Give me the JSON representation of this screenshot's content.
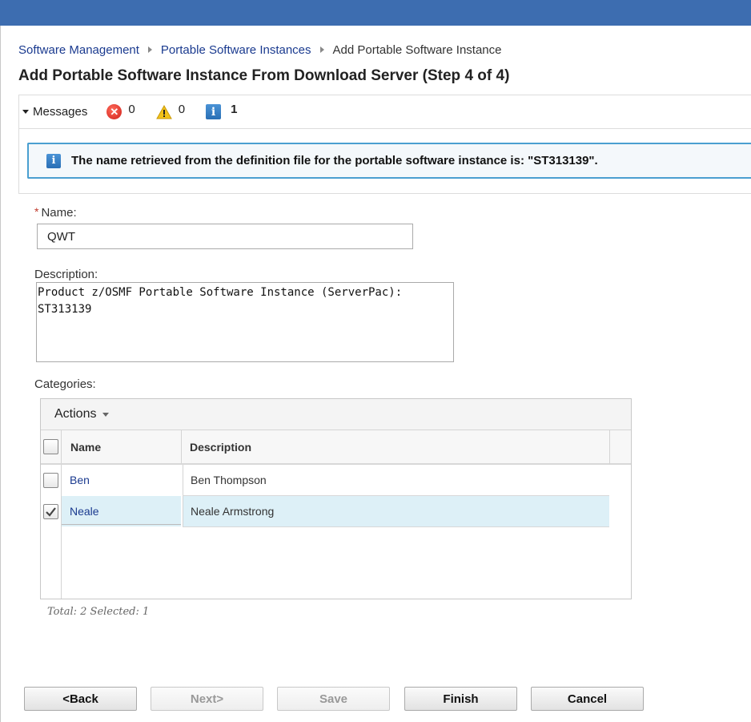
{
  "breadcrumb": {
    "items": [
      "Software Management",
      "Portable Software Instances"
    ],
    "current": "Add Portable Software Instance"
  },
  "page_title": "Add Portable Software Instance From Download Server (Step 4 of 4)",
  "messages": {
    "label": "Messages",
    "error_count": "0",
    "warning_count": "0",
    "info_count": "1",
    "info_text": "The name retrieved from the definition file for the portable software instance is: \"ST313139\"."
  },
  "form": {
    "name_required_marker": "*",
    "name_label": "Name:",
    "name_value": "QWT",
    "description_label": "Description:",
    "description_value": "Product z/OSMF Portable Software Instance (ServerPac):\nST313139",
    "categories_label": "Categories:"
  },
  "categories_table": {
    "actions_label": "Actions",
    "columns": [
      "Name",
      "Description"
    ],
    "rows": [
      {
        "name": "Ben",
        "description": "Ben Thompson",
        "selected": false
      },
      {
        "name": "Neale",
        "description": "Neale Armstrong",
        "selected": true
      }
    ],
    "summary": "Total: 2 Selected: 1"
  },
  "buttons": {
    "back": "<Back",
    "next": "Next>",
    "save": "Save",
    "finish": "Finish",
    "cancel": "Cancel"
  },
  "colors": {
    "topbar": "#3d6db0",
    "link": "#1a3a8f",
    "selected_row": "#ddf0f7",
    "info_border": "#4a9fd0"
  }
}
